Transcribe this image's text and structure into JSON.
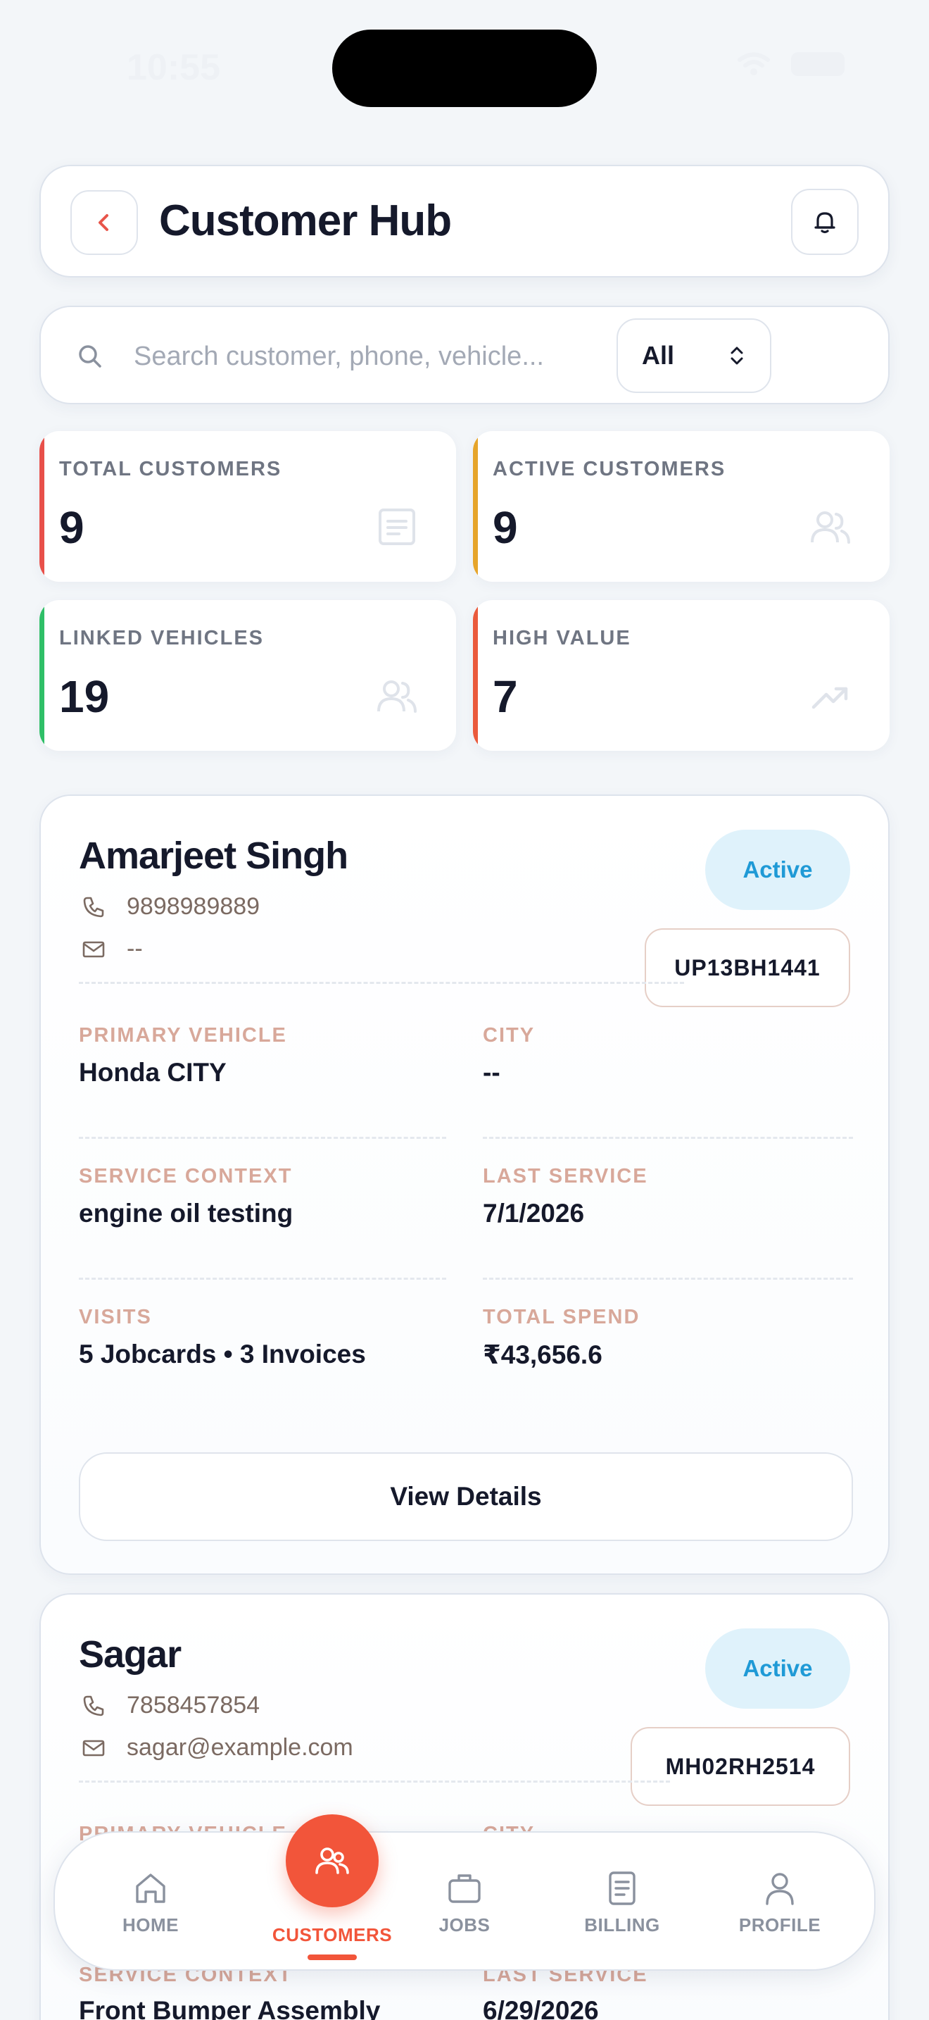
{
  "status_bar": {
    "time": "10:55"
  },
  "header": {
    "title": "Customer Hub"
  },
  "search": {
    "placeholder": "Search customer, phone, vehicle...",
    "filter_value": "All"
  },
  "stats": [
    {
      "label": "TOTAL CUSTOMERS",
      "value": "9",
      "accent": "#e8504a",
      "icon": "document-icon"
    },
    {
      "label": "ACTIVE CUSTOMERS",
      "value": "9",
      "accent": "#e6a52b",
      "icon": "users-icon"
    },
    {
      "label": "LINKED VEHICLES",
      "value": "19",
      "accent": "#2fbf67",
      "icon": "users-icon"
    },
    {
      "label": "HIGH VALUE",
      "value": "7",
      "accent": "#ea5a3c",
      "icon": "trending-up-icon"
    }
  ],
  "customers": [
    {
      "name": "Amarjeet Singh",
      "phone": "9898989889",
      "email": "--",
      "status": "Active",
      "plate": "UP13BH1441",
      "primary_vehicle_label": "PRIMARY VEHICLE",
      "primary_vehicle": "Honda CITY",
      "city_label": "CITY",
      "city": "--",
      "service_context_label": "SERVICE CONTEXT",
      "service_context": "engine oil testing",
      "last_service_label": "LAST SERVICE",
      "last_service": "7/1/2026",
      "visits_label": "VISITS",
      "visits": "5 Jobcards • 3 Invoices",
      "total_spend_label": "TOTAL SPEND",
      "total_spend": "₹43,656.6",
      "details_label": "View Details"
    },
    {
      "name": "Sagar",
      "phone": "7858457854",
      "email": "sagar@example.com",
      "status": "Active",
      "plate": "MH02RH2514",
      "primary_vehicle_label": "PRIMARY VEHICLE",
      "city_label": "CITY",
      "service_context_label": "SERVICE CONTEXT",
      "service_context": "Front Bumper Assembly",
      "last_service_label": "LAST SERVICE",
      "last_service": "6/29/2026"
    }
  ],
  "nav": {
    "home": "HOME",
    "customers": "CUSTOMERS",
    "jobs": "JOBS",
    "billing": "BILLING",
    "profile": "PROFILE"
  },
  "colors": {
    "accent": "#f2553a",
    "active_badge": "#1f9ad6",
    "label": "#d8a89a"
  }
}
